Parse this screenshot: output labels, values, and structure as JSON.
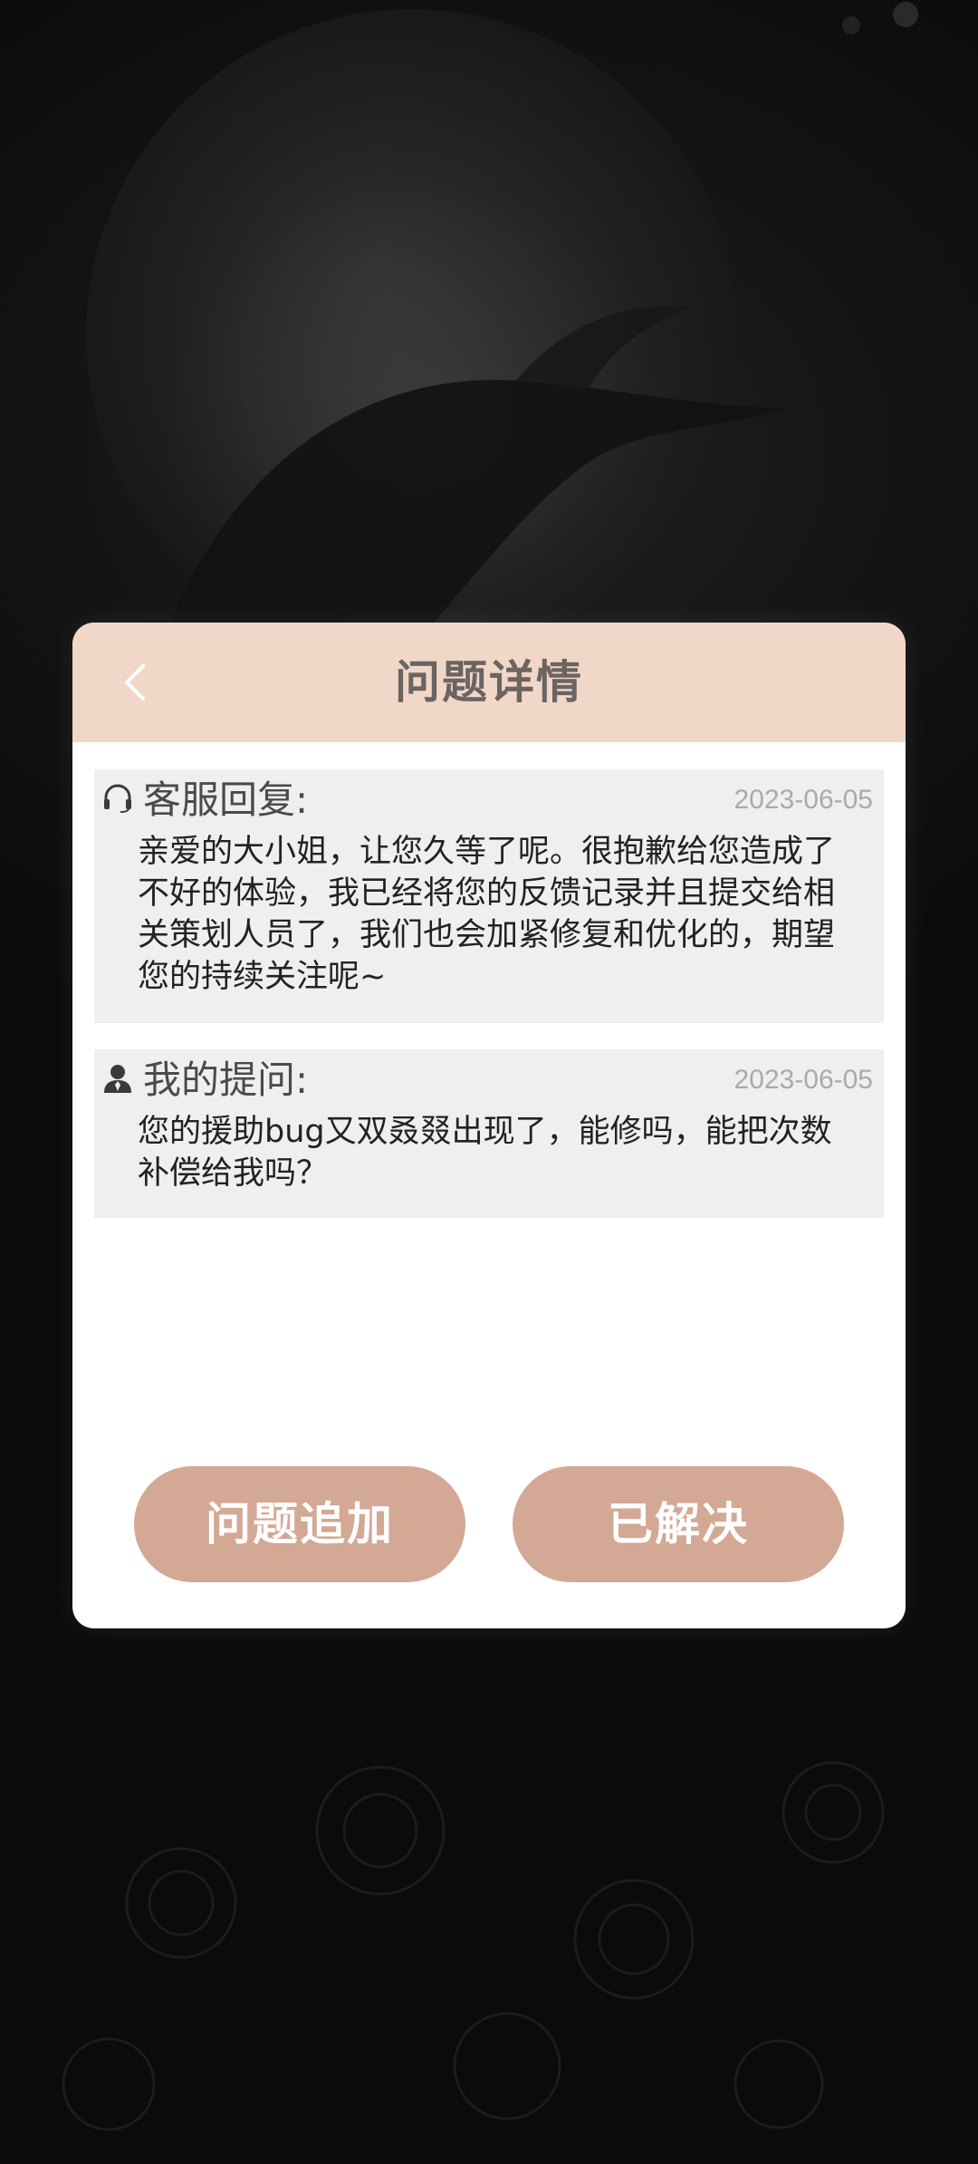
{
  "dialog": {
    "title": "问题详情"
  },
  "reply": {
    "label": "客服回复:",
    "date": "2023-06-05",
    "text": "亲爱的大小姐，让您久等了呢。很抱歉给您造成了不好的体验，我已经将您的反馈记录并且提交给相关策划人员了，我们也会加紧修复和优化的，期望您的持续关注呢~",
    "icon": "headset-icon"
  },
  "question": {
    "label": "我的提问:",
    "date": "2023-06-05",
    "text": "您的援助bug又双叒叕出现了，能修吗，能把次数补偿给我吗？",
    "icon": "user-icon"
  },
  "buttons": {
    "append_label": "问题追加",
    "resolved_label": "已解决"
  },
  "colors": {
    "header_bg": "#f1d7c8",
    "button_bg": "#d3a894",
    "message_bg": "#efefef",
    "title_text": "#6b6461",
    "date_text": "#aaaaaa"
  }
}
